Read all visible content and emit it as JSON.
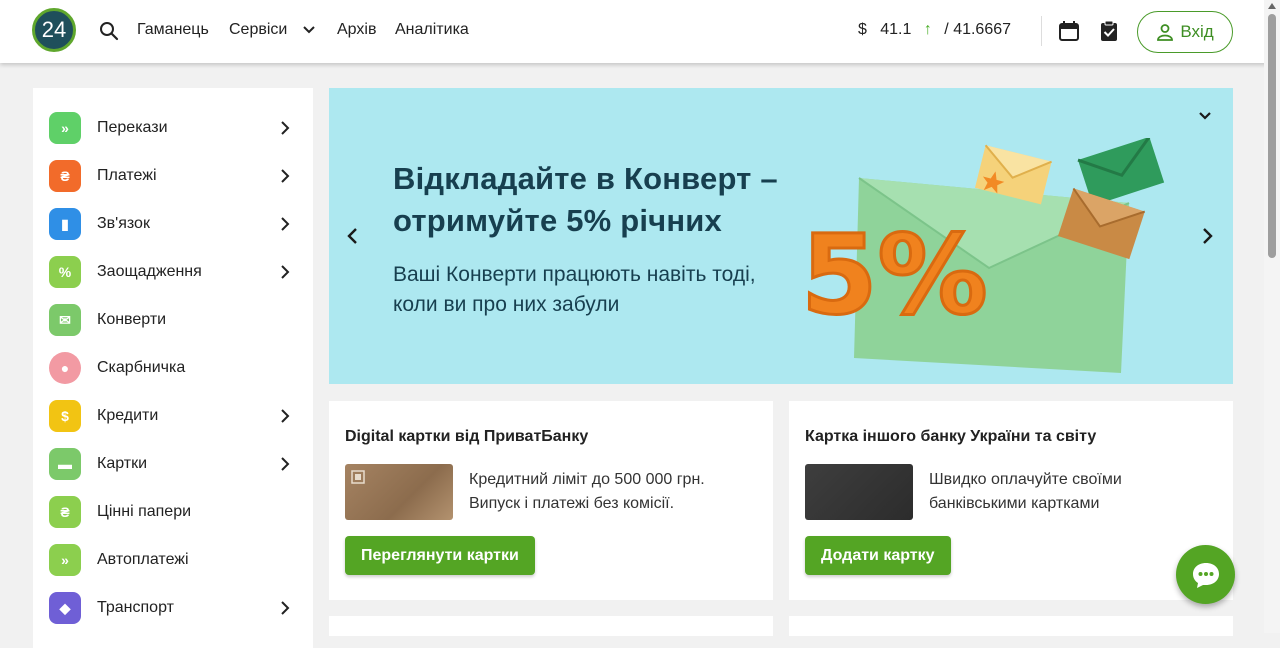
{
  "header": {
    "logo_text": "24",
    "nav": [
      "Гаманець",
      "Сервіси",
      "Архів",
      "Аналітика"
    ],
    "rate": {
      "currency_symbol": "$",
      "buy": "41.1",
      "trend_arrow": "↑",
      "sell": "/ 41.6667"
    },
    "login_label": "Вхід"
  },
  "sidebar": {
    "items": [
      {
        "label": "Перекази",
        "icon": "transfer-icon",
        "color": "#5fd068",
        "has_arrow": true,
        "glyph": "»"
      },
      {
        "label": "Платежі",
        "icon": "payment-icon",
        "color": "#f26b2a",
        "has_arrow": true,
        "glyph": "₴"
      },
      {
        "label": "Зв'язок",
        "icon": "signal-icon",
        "color": "#2f8fe6",
        "has_arrow": true,
        "glyph": "▮"
      },
      {
        "label": "Заощадження",
        "icon": "savings-icon",
        "color": "#8ccf4e",
        "has_arrow": true,
        "glyph": "%"
      },
      {
        "label": "Конверти",
        "icon": "envelope-icon",
        "color": "#7cc96a",
        "has_arrow": false,
        "glyph": "✉"
      },
      {
        "label": "Скарбничка",
        "icon": "piggy-bank-icon",
        "color": "#f29aa3",
        "has_arrow": false,
        "glyph": "●"
      },
      {
        "label": "Кредити",
        "icon": "money-bag-icon",
        "color": "#f2c413",
        "has_arrow": true,
        "glyph": "$"
      },
      {
        "label": "Картки",
        "icon": "card-icon",
        "color": "#7cc96a",
        "has_arrow": true,
        "glyph": "▬"
      },
      {
        "label": "Цінні папери",
        "icon": "document-icon",
        "color": "#8ccf4e",
        "has_arrow": false,
        "glyph": "₴"
      },
      {
        "label": "Автоплатежі",
        "icon": "calendar-icon",
        "color": "#8ccf4e",
        "has_arrow": false,
        "glyph": "»"
      },
      {
        "label": "Транспорт",
        "icon": "ticket-icon",
        "color": "#6f5fd6",
        "has_arrow": true,
        "glyph": "◆"
      }
    ]
  },
  "banner": {
    "title": "Відкладайте в Конверт – отримуйте 5% річних",
    "subtitle": "Ваші Конверти працюють навіть тоді, коли ви про них забули",
    "art_text": "5%"
  },
  "cards": [
    {
      "title": "Digital картки від ПриватБанку",
      "text": "Кредитний ліміт до 500 000 грн. Випуск і платежі без комісії.",
      "button": "Переглянути картки"
    },
    {
      "title": "Картка іншого банку України та світу",
      "text": "Швидко оплачуйте своїми банківськими картками",
      "button": "Додати картку"
    }
  ]
}
